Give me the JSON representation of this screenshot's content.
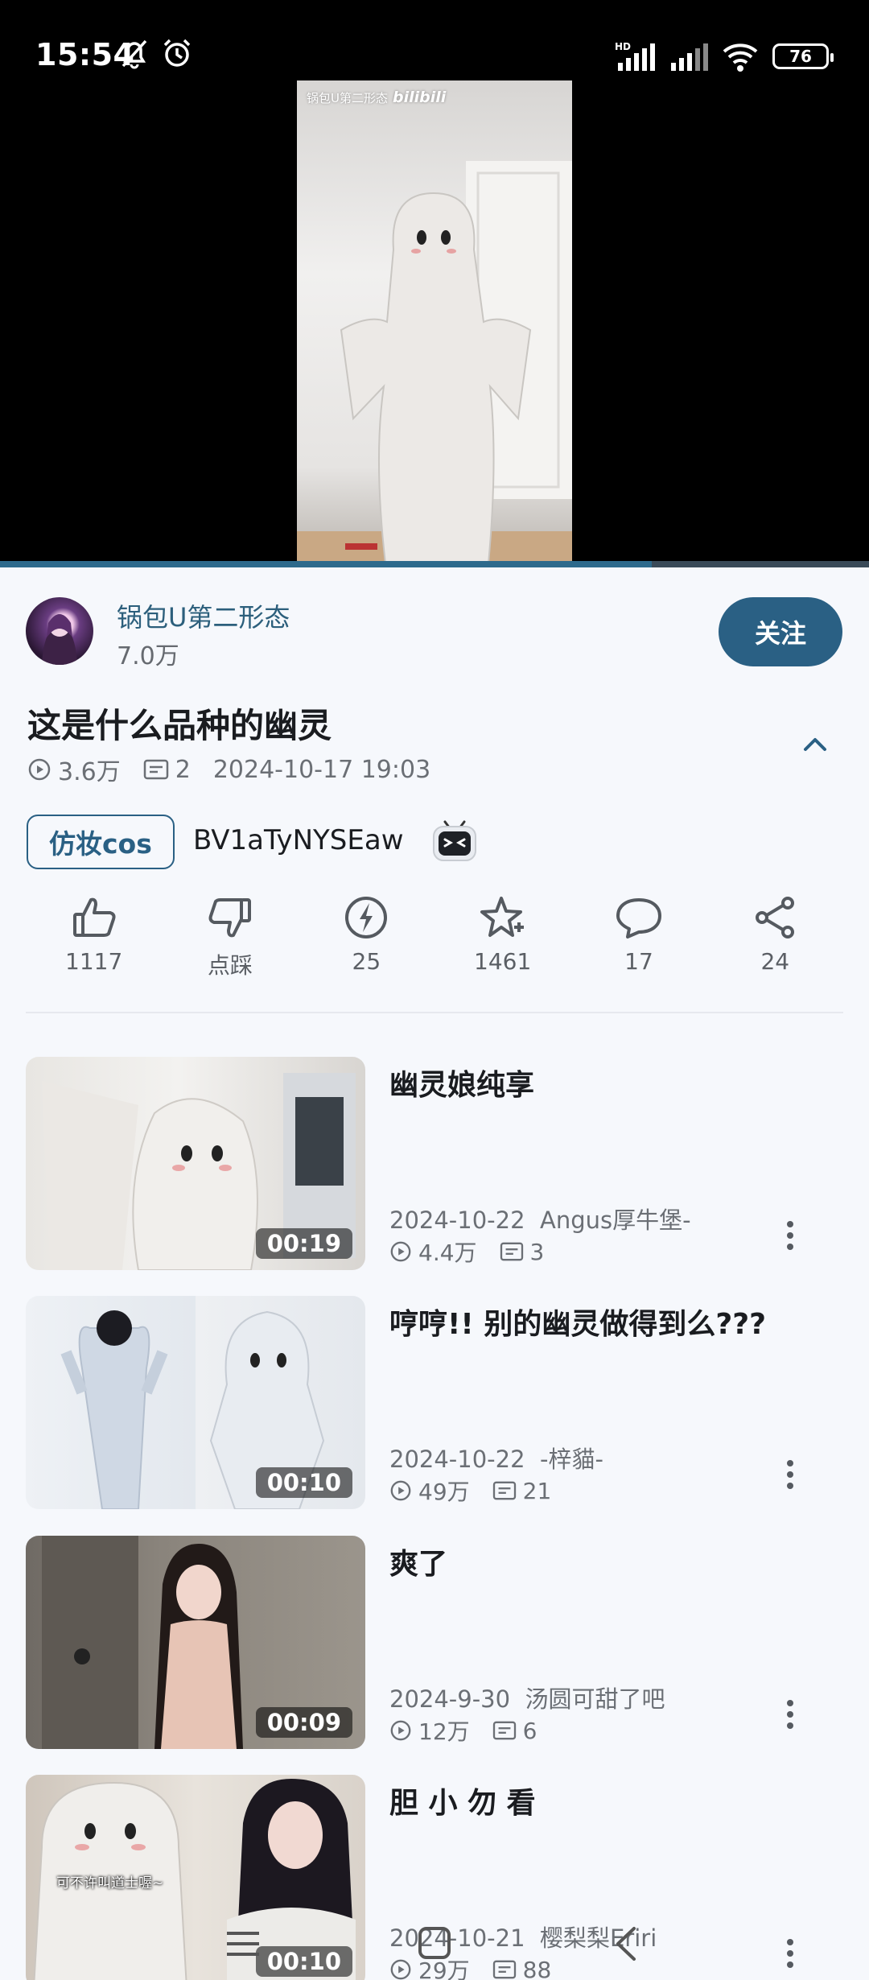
{
  "status_bar": {
    "time": "15:54",
    "battery": "76",
    "network": "HD"
  },
  "video": {
    "watermark_uploader": "锅包U第二形态",
    "watermark_brand": "bilibili",
    "progress": 0.75
  },
  "uploader": {
    "name": "锅包U第二形态",
    "fans": "7.0万",
    "follow_label": "关注"
  },
  "info": {
    "title": "这是什么品种的幽灵",
    "views": "3.6万",
    "danmaku": "2",
    "datetime": "2024-10-17 19:03",
    "tag": "仿妆cos",
    "bvid": "BV1aTyNYSEaw"
  },
  "actions": [
    {
      "name": "like",
      "label": "1117"
    },
    {
      "name": "dislike",
      "label": "点踩"
    },
    {
      "name": "coin",
      "label": "25"
    },
    {
      "name": "favorite",
      "label": "1461"
    },
    {
      "name": "comment",
      "label": "17"
    },
    {
      "name": "share",
      "label": "24"
    }
  ],
  "related": [
    {
      "title": "幽灵娘纯享",
      "date": "2024-10-22",
      "author": "Angus厚牛堡-",
      "views": "4.4万",
      "danmaku": "3",
      "duration": "00:19"
    },
    {
      "title": "哼哼!! 别的幽灵做得到么???",
      "date": "2024-10-22",
      "author": "-梓貓-",
      "views": "49万",
      "danmaku": "21",
      "duration": "00:10"
    },
    {
      "title": "爽了",
      "date": "2024-9-30",
      "author": "汤圆可甜了吧",
      "views": "12万",
      "danmaku": "6",
      "duration": "00:09"
    },
    {
      "title": "胆 小 勿 看",
      "date": "2024-10-21",
      "author": "樱梨梨Eriri",
      "views": "29万",
      "danmaku": "88",
      "duration": "00:10",
      "overlay_text": "可不许叫道士喔~"
    }
  ],
  "colors": {
    "accent": "#2a6084",
    "link": "#2c5f7c",
    "background": "#f6f8fc"
  }
}
